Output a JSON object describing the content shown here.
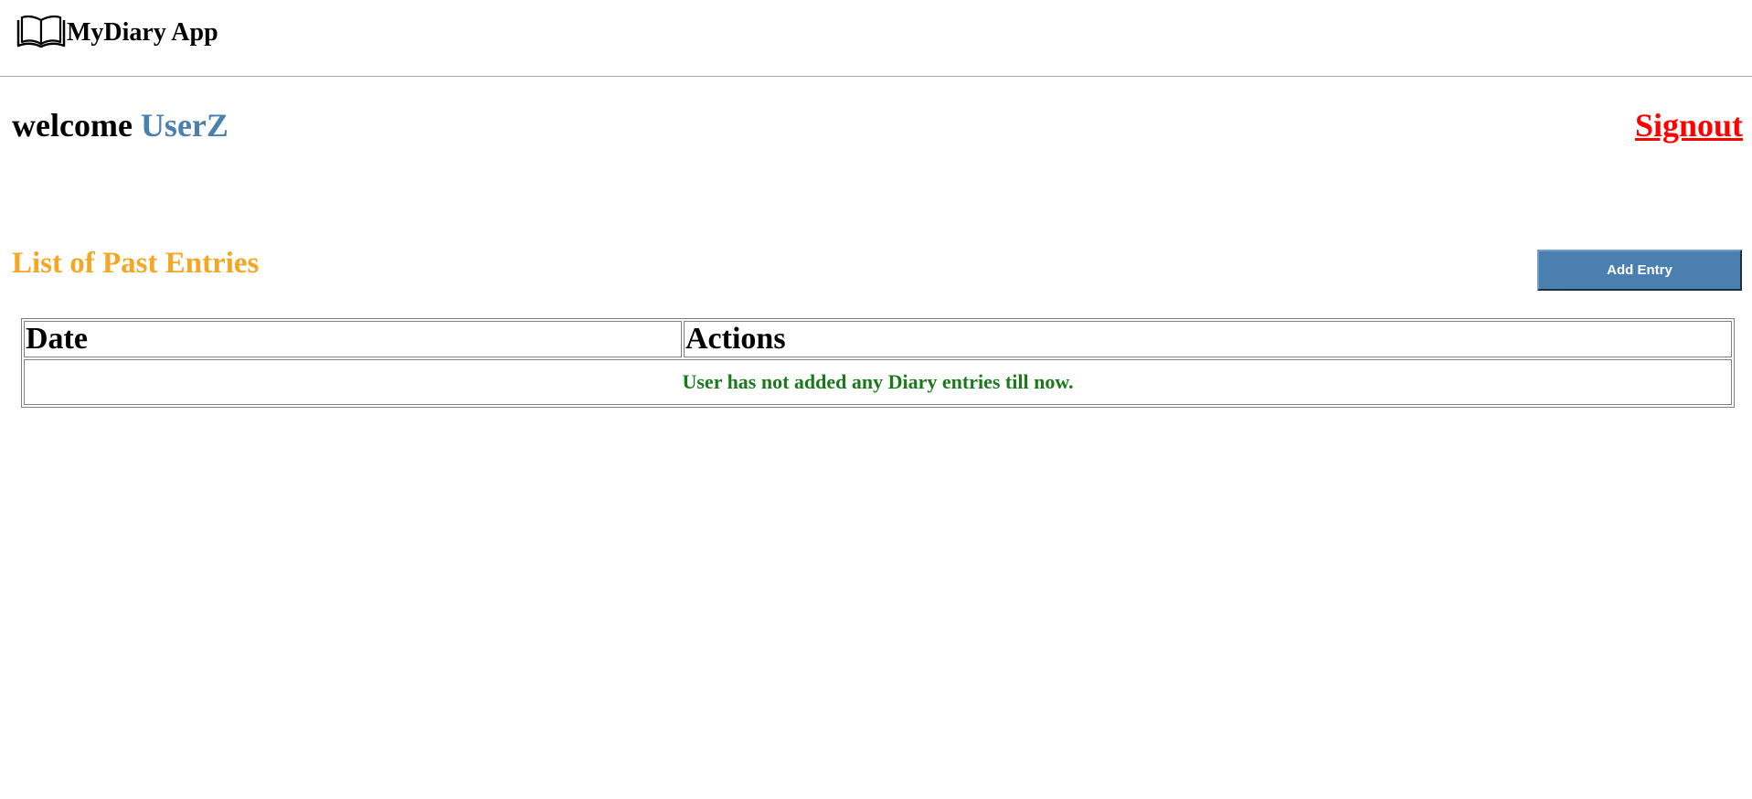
{
  "header": {
    "app_title": "MyDiary App",
    "logo_icon": "open-book-icon"
  },
  "welcome": {
    "greeting": "welcome",
    "username": "UserZ",
    "username_color": "#4a7fb0"
  },
  "signout": {
    "label": "Signout",
    "color": "#ff0000"
  },
  "entries_section": {
    "title": "List of Past Entries",
    "title_color": "#f5a623",
    "add_button_label": "Add Entry",
    "add_button_color": "#4a7fb0"
  },
  "table": {
    "columns": [
      "Date",
      "Actions"
    ],
    "empty_message": "User has not added any Diary entries till now.",
    "empty_message_color": "#1a7a1a"
  }
}
